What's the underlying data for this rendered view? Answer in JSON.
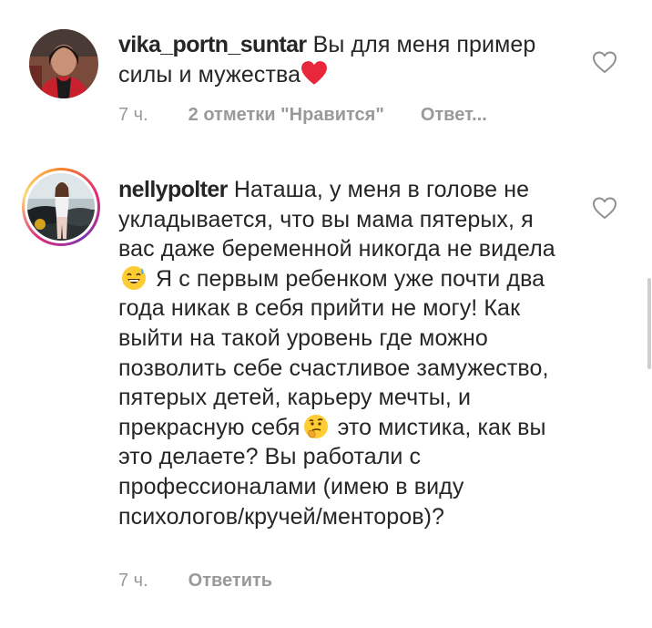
{
  "comments": [
    {
      "username": "vika_portn_suntar",
      "text_before": " Вы для меня пример силы и мужества",
      "emoji_end": "red-heart",
      "time": "7 ч.",
      "likes": "2 отметки \"Нравится\"",
      "reply": "Ответ..."
    },
    {
      "username": "nellypolter",
      "text_part1": " Наташа, у меня в голове не укладывается, что вы мама пятерых, я вас даже беременной никогда не видела",
      "emoji1": "sweat-smile",
      "text_part2": " Я с первым ребенком уже почти два года никак в себя прийти не могу! Как выйти на такой уровень где можно позволить себе счастливое замужество, пятерых детей, карьеру мечты, и прекрасную себя",
      "emoji2": "thinking-face",
      "text_part3": " это мистика, как вы это делаете? Вы работали с профессионалами (имею в виду психологов/кручей/менторов)?",
      "time": "7 ч.",
      "reply": "Ответить"
    }
  ],
  "colors": {
    "text": "#262626",
    "meta": "#999999",
    "heart_red": "#e8273a",
    "story_ring": "#dd2a7b"
  }
}
